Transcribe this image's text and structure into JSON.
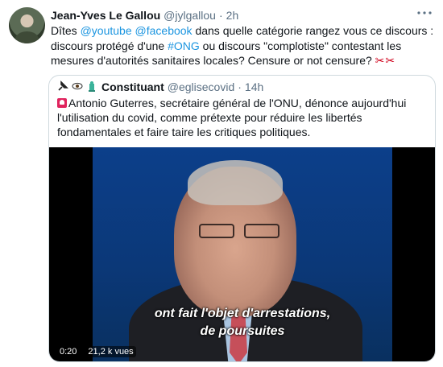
{
  "tweet": {
    "author_name": "Jean-Yves Le Gallou",
    "author_handle": "@jylgallou",
    "separator": "·",
    "time": "2h",
    "more_icon": "more-icon",
    "text_parts": {
      "p1": "Dîtes ",
      "mention1": "@youtube",
      "p2": " ",
      "mention2": "@facebook",
      "p3": " dans quelle catégorie rangez vous ce discours : discours protégé d'une ",
      "hashtag": "#ONG",
      "p4": " ou discours \"complotiste\" contestant les mesures d'autorités sanitaires locales? Censure or not censure? "
    },
    "emoji": "scissors-icon"
  },
  "quoted_tweet": {
    "author_icons": [
      "pin-icon",
      "eye-icon",
      "statue-icon"
    ],
    "author_name": "Constituant",
    "author_handle": "@eglisecovid",
    "separator": "·",
    "time": "14h",
    "leading_icon": "siren-icon",
    "text": "Antonio Guterres, secrétaire général de l'ONU, dénonce aujourd'hui l'utilisation du covid, comme prétexte pour réduire les libertés fondamentales et faire taire les critiques politiques.",
    "video": {
      "caption_line1": "ont fait l'objet d'arrestations,",
      "caption_line2": "de poursuites",
      "duration": "0:20",
      "views": "21,2 k vues"
    }
  },
  "colors": {
    "link": "#1b95e0",
    "secondary_text": "#5b7083",
    "border": "#cfd9de"
  }
}
